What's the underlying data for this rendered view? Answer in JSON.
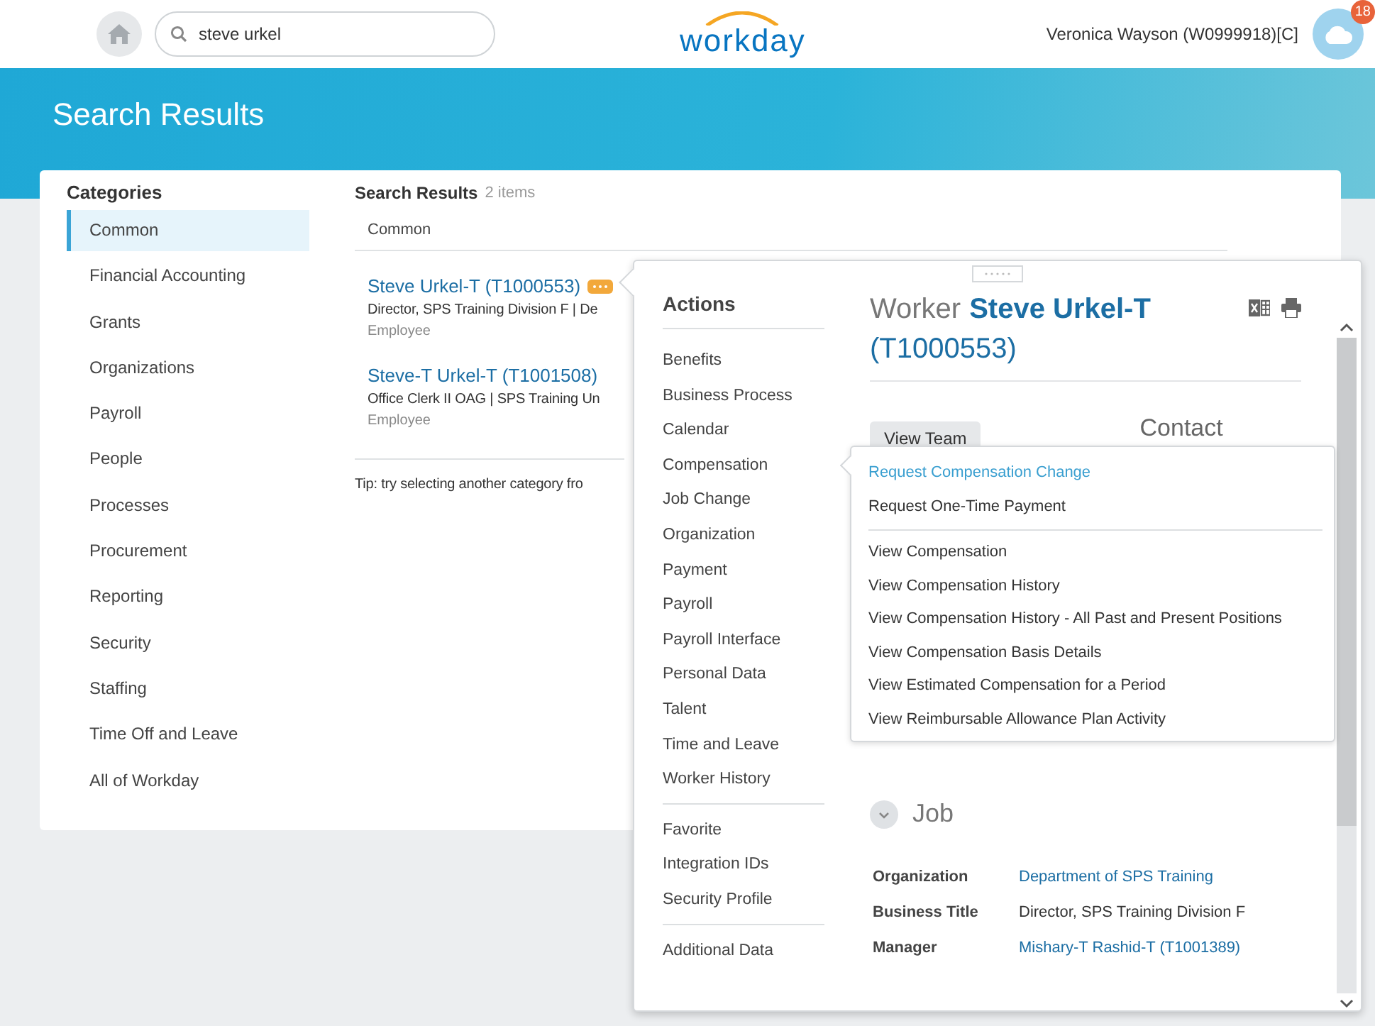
{
  "header": {
    "search": {
      "value": "steve urkel"
    },
    "logo": "workday",
    "user": "Veronica Wayson (W0999918)[C]",
    "notifications": "18"
  },
  "page_title": "Search Results",
  "categories": {
    "title": "Categories",
    "items": [
      {
        "label": "Common",
        "selected": true
      },
      {
        "label": "Financial Accounting",
        "selected": false
      },
      {
        "label": "Grants",
        "selected": false
      },
      {
        "label": "Organizations",
        "selected": false
      },
      {
        "label": "Payroll",
        "selected": false
      },
      {
        "label": "People",
        "selected": false
      },
      {
        "label": "Processes",
        "selected": false
      },
      {
        "label": "Procurement",
        "selected": false
      },
      {
        "label": "Reporting",
        "selected": false
      },
      {
        "label": "Security",
        "selected": false
      },
      {
        "label": "Staffing",
        "selected": false
      },
      {
        "label": "Time Off and Leave",
        "selected": false
      },
      {
        "label": "All of Workday",
        "selected": false
      }
    ]
  },
  "results": {
    "title": "Search Results",
    "count": "2 items",
    "group": "Common",
    "items": [
      {
        "name": "Steve Urkel-T (T1000553)",
        "detail": "Director, SPS Training Division F | De",
        "type": "Employee",
        "actions_open": true
      },
      {
        "name": "Steve-T Urkel-T (T1001508)",
        "detail": "Office Clerk II OAG | SPS Training Un",
        "type": "Employee",
        "actions_open": false
      }
    ],
    "tip": "Tip: try selecting another category fro"
  },
  "popup": {
    "actions_title": "Actions",
    "action_groups": [
      [
        "Benefits",
        "Business Process",
        "Calendar",
        "Compensation",
        "Job Change",
        "Organization",
        "Payment",
        "Payroll",
        "Payroll Interface",
        "Personal Data",
        "Talent",
        "Time and Leave",
        "Worker History"
      ],
      [
        "Favorite",
        "Integration IDs",
        "Security Profile"
      ],
      [
        "Additional Data"
      ]
    ],
    "worker": {
      "label": "Worker",
      "name": "Steve Urkel-T",
      "id": "(T1000553)"
    },
    "view_team": "View Team",
    "contact": "Contact",
    "submenu": {
      "groups": [
        [
          {
            "label": "Request Compensation Change",
            "selected": true
          },
          {
            "label": "Request One-Time Payment",
            "selected": false
          }
        ],
        [
          {
            "label": "View Compensation",
            "selected": false
          },
          {
            "label": "View Compensation History",
            "selected": false
          },
          {
            "label": "View Compensation History - All Past and Present Positions",
            "selected": false
          },
          {
            "label": "View Compensation Basis Details",
            "selected": false
          },
          {
            "label": "View Estimated Compensation for a Period",
            "selected": false
          },
          {
            "label": "View Reimbursable Allowance Plan Activity",
            "selected": false
          }
        ]
      ]
    },
    "job": {
      "title": "Job",
      "fields": [
        {
          "label": "Organization",
          "value": "Department of SPS Training",
          "link": true
        },
        {
          "label": "Business Title",
          "value": "Director, SPS Training Division F",
          "link": false
        },
        {
          "label": "Manager",
          "value": "Mishary-T Rashid-T (T1001389)",
          "link": true
        }
      ]
    }
  }
}
